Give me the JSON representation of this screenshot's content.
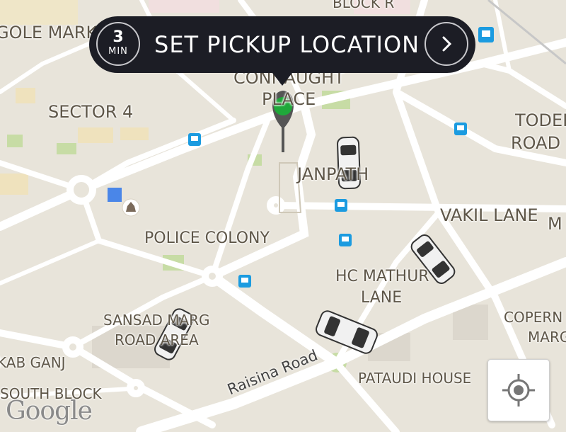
{
  "pickup_banner": {
    "eta_value": "3",
    "eta_unit": "MIN",
    "title": "SET PICKUP LOCATION"
  },
  "map_labels": {
    "gole_market": "GOLE MARKET",
    "sector_4": "SECTOR 4",
    "connaught_place_1": "CONNAUGHT",
    "connaught_place_2": "PLACE",
    "janpath": "JANPATH",
    "todar_1": "TODER",
    "todar_2": "ROAD",
    "vakil_lane": "VAKIL LANE",
    "vakil_m": "M",
    "police_colony": "POLICE COLONY",
    "hc_mathur_1": "HC MATHUR",
    "hc_mathur_2": "LANE",
    "sansad_1": "SANSAD MARG",
    "sansad_2": "ROAD AREA",
    "copernicus_1": "COPERN",
    "copernicus_2": "MARG",
    "kab_ganj": "KAB GANJ",
    "pataudi_house": "PATAUDI HOUSE",
    "south_block": "SOUTH BLOCK",
    "raisina_road": "Raisina Road",
    "block_r": "BLOCK R"
  },
  "google_logo": "Google",
  "icons": {
    "metro": "metro-icon",
    "bus": "bus-stop-icon",
    "pin": "pickup-pin-icon",
    "car": "car-icon",
    "locate": "my-location-icon",
    "chevron": "chevron-right-icon"
  },
  "colors": {
    "banner_bg": "#1c1d25",
    "pin_green": "#1fa83a",
    "map_bg": "#e8e4da",
    "road": "#ffffff",
    "park": "#c7dca5",
    "bus_blue": "#1b9be0"
  }
}
